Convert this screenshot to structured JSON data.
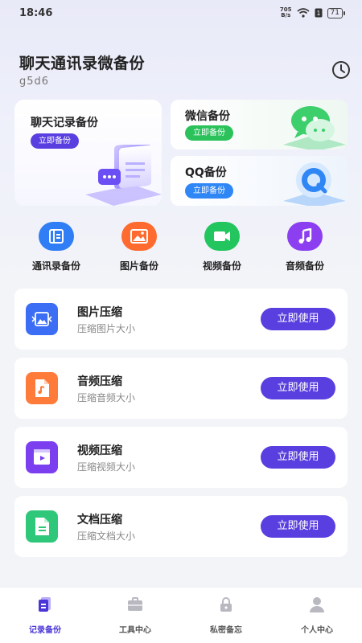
{
  "status_bar": {
    "time": "18:46",
    "net_speed_value": "705",
    "net_speed_unit": "B/s",
    "battery": "71"
  },
  "header": {
    "title": "聊天通讯录微备份",
    "user_id": "g5d6"
  },
  "backup_cards": {
    "chat": {
      "title": "聊天记录备份",
      "button": "立即备份"
    },
    "wechat": {
      "title": "微信备份",
      "button": "立即备份"
    },
    "qq": {
      "title": "QQ备份",
      "button": "立即备份"
    }
  },
  "quick_actions": [
    {
      "label": "通讯录备份",
      "icon": "contacts-icon",
      "color": "#2f7ef5"
    },
    {
      "label": "图片备份",
      "icon": "image-icon",
      "color": "#ff6a2e"
    },
    {
      "label": "视频备份",
      "icon": "video-icon",
      "color": "#22c55e"
    },
    {
      "label": "音频备份",
      "icon": "music-icon",
      "color": "#8b3ff0"
    }
  ],
  "compress_list": [
    {
      "title": "图片压缩",
      "subtitle": "压缩图片大小",
      "button": "立即使用",
      "icon": "image-compress-icon",
      "color": "#3b6ef5"
    },
    {
      "title": "音频压缩",
      "subtitle": "压缩音频大小",
      "button": "立即使用",
      "icon": "audio-file-icon",
      "color": "#ff7b3a"
    },
    {
      "title": "视频压缩",
      "subtitle": "压缩视频大小",
      "button": "立即使用",
      "icon": "video-file-icon",
      "color": "#7b3ff0"
    },
    {
      "title": "文档压缩",
      "subtitle": "压缩文档大小",
      "button": "立即使用",
      "icon": "document-icon",
      "color": "#2fc77a"
    }
  ],
  "tabbar": [
    {
      "label": "记录备份",
      "icon": "record-backup-icon",
      "active": true
    },
    {
      "label": "工具中心",
      "icon": "toolbox-icon",
      "active": false
    },
    {
      "label": "私密备忘",
      "icon": "lock-icon",
      "active": false
    },
    {
      "label": "个人中心",
      "icon": "person-icon",
      "active": false
    }
  ],
  "colors": {
    "accent": "#5a3fe0",
    "wechat_green": "#2bc25c",
    "qq_blue": "#2f86f5"
  }
}
